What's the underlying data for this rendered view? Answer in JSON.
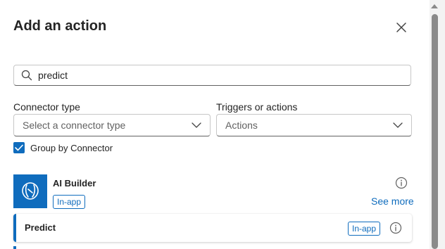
{
  "panel": {
    "title": "Add an action"
  },
  "search": {
    "value": "predict",
    "placeholder": ""
  },
  "filters": {
    "connector_type_label": "Connector type",
    "connector_type_placeholder": "Select a connector type",
    "triggers_label": "Triggers or actions",
    "triggers_value": "Actions"
  },
  "group_by": {
    "label": "Group by Connector",
    "checked": true
  },
  "connector": {
    "name": "AI Builder",
    "badge": "In-app",
    "see_more": "See more"
  },
  "actions": [
    {
      "name": "Predict",
      "badge": "In-app"
    }
  ],
  "colors": {
    "accent": "#0f6cbd",
    "text": "#242424",
    "muted": "#616161"
  },
  "icons": {
    "close": "close-icon",
    "search": "search-icon",
    "chevron": "chevron-down-icon",
    "check": "checkmark-icon",
    "info": "info-icon",
    "connector_logo": "ai-builder-logo"
  }
}
